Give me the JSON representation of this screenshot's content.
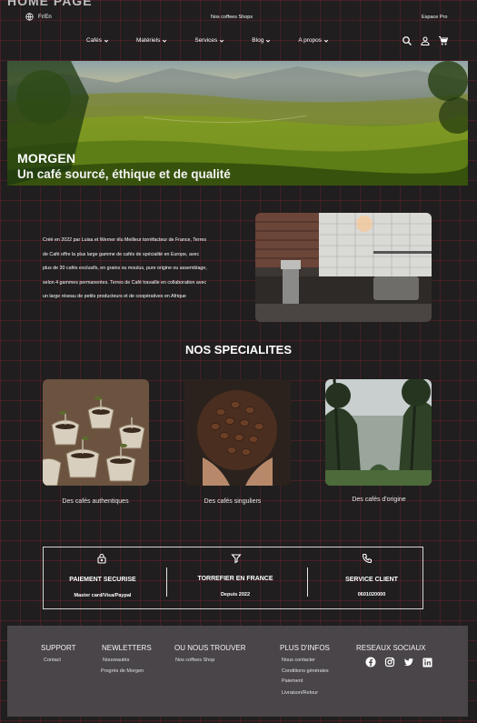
{
  "frame_label": "HOME PAGE",
  "header": {
    "language": "Fr/En",
    "shop_name": "Nos coffees Shops",
    "espace_pro": "Espace Pro",
    "nav": [
      "Cafés",
      "Matériels",
      "Services",
      "Blog",
      "A propos"
    ]
  },
  "hero": {
    "title": "MORGEN",
    "subtitle": "Un café sourcé, éthique et de qualité"
  },
  "intro": {
    "lines": [
      "Créé en 2022 par Luisa et Werner élu Meilleur torréfacteur de France, Terres",
      "de Café offre la plus large gamme de cafés de spécialité en Europe, avec",
      "plus de 30 cafés exclusifs, en grains ou moulus, pure origine ou assemblage,",
      "selon 4 gammes permanentes. Terres de Café travaille en collaboration avec",
      "un large réseau de petits producteurs et de coopératives en Afrique"
    ]
  },
  "specialties": {
    "title": "NOS SPECIALITES",
    "cards": [
      {
        "label": "Des cafés authentiques"
      },
      {
        "label": "Des cafés singuliers"
      },
      {
        "label": "Des cafés d'origine"
      }
    ]
  },
  "features": [
    {
      "icon": "lock-icon",
      "title": "PAIEMENT SECURISE",
      "subtitle": "Master card/Visa/Paypal"
    },
    {
      "icon": "filter-icon",
      "title": "TORREFIER EN FRANCE",
      "subtitle": "Depuis 2022"
    },
    {
      "icon": "phone-icon",
      "title": "SERVICE CLIENT",
      "subtitle": "0601020000"
    }
  ],
  "footer": {
    "support": {
      "title": "SUPPORT",
      "links": [
        "Contact"
      ]
    },
    "newsletters": {
      "title": "NEWLETTERS",
      "links": [
        "Nouveautés",
        "Progrès de Morgen"
      ]
    },
    "find_us": {
      "title": "OU NOUS TROUVER",
      "links": [
        "Nos coffees Shop"
      ]
    },
    "more_info": {
      "title": "PLUS D'INFOS",
      "links": [
        "Nous contacter",
        "Conditions générales",
        "Paiement",
        "Livraison/Retour"
      ]
    },
    "social": {
      "title": "RESEAUX SOCIAUX",
      "icons": [
        "facebook-icon",
        "instagram-icon",
        "twitter-icon",
        "linkedin-icon"
      ]
    }
  }
}
